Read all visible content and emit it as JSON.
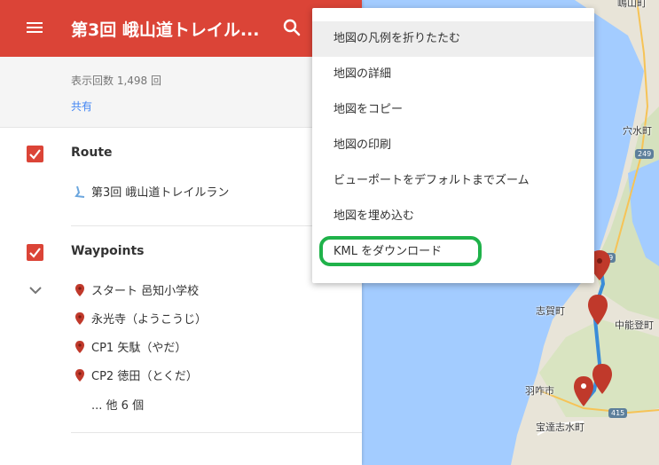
{
  "header": {
    "title": "第3回 峨山道トレイル...",
    "menu_icon": "hamburger-menu-icon",
    "search_icon": "search-icon"
  },
  "info": {
    "views": "表示回数 1,498 回",
    "share": "共有"
  },
  "layers": [
    {
      "title": "Route",
      "items": [
        {
          "label": "第3回 峨山道トレイルラン",
          "icon": "route-line-icon"
        }
      ]
    },
    {
      "title": "Waypoints",
      "items": [
        {
          "label": "スタート 邑知小学校",
          "icon": "map-pin-icon"
        },
        {
          "label": "永光寺（ようこうじ）",
          "icon": "map-pin-icon"
        },
        {
          "label": "CP1 矢駄（やだ）",
          "icon": "map-pin-icon"
        },
        {
          "label": "CP2 徳田（とくだ）",
          "icon": "map-pin-icon"
        }
      ],
      "more": "... 他 6 個"
    }
  ],
  "menu": {
    "items": [
      "地図の凡例を折りたたむ",
      "地図の詳細",
      "地図をコピー",
      "地図の印刷",
      "ビューポートをデフォルトまでズーム",
      "地図を埋め込む",
      "KML をダウンロード"
    ],
    "hovered_index": 0,
    "highlighted_index": 6
  },
  "map": {
    "labels": {
      "top": "嶋山町",
      "anamizu": "穴水町",
      "shika": "志賀町",
      "nakanoto": "中能登町",
      "hakui": "羽咋市",
      "hodatsu": "宝達志水町"
    },
    "roads": {
      "r249a": "249",
      "r249b": "49",
      "r415": "415"
    }
  },
  "colors": {
    "header": "#db4437",
    "checkbox": "#db4437",
    "link": "#4285f4",
    "highlight": "#1fb24a",
    "water": "#a3ccff",
    "land": "#e8e4d8",
    "route": "#3a8cd8"
  }
}
